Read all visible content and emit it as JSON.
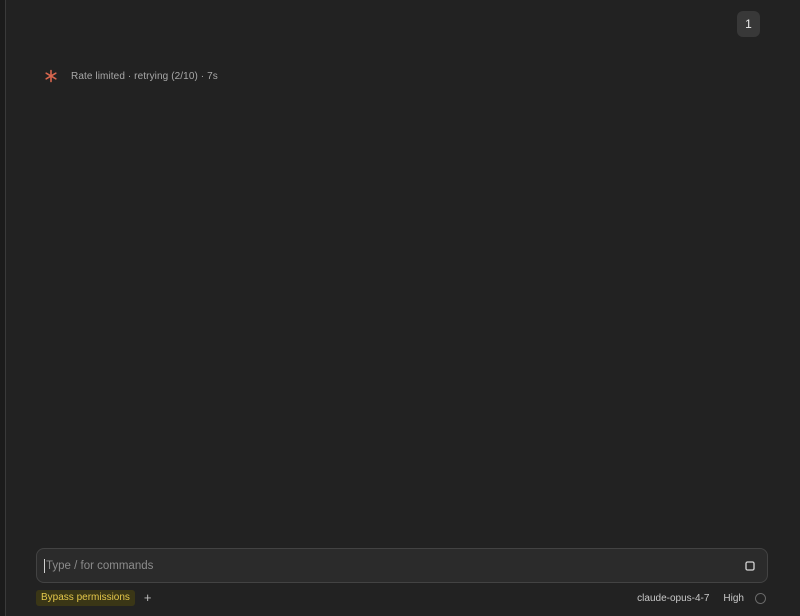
{
  "header": {
    "message_count": "1"
  },
  "status": {
    "icon": "spark-icon",
    "icon_color": "#d9674f",
    "text": "Rate limited · retrying (2/10) · 7s"
  },
  "composer": {
    "placeholder": "Type / for commands",
    "value": "",
    "stop_icon": "stop-square-icon"
  },
  "footer": {
    "permission_mode": "Bypass permissions",
    "permission_color": "#e4c74a",
    "add_icon": "plus-icon",
    "model": "claude-opus-4-7",
    "effort": "High",
    "context_icon": "context-ring-icon"
  }
}
